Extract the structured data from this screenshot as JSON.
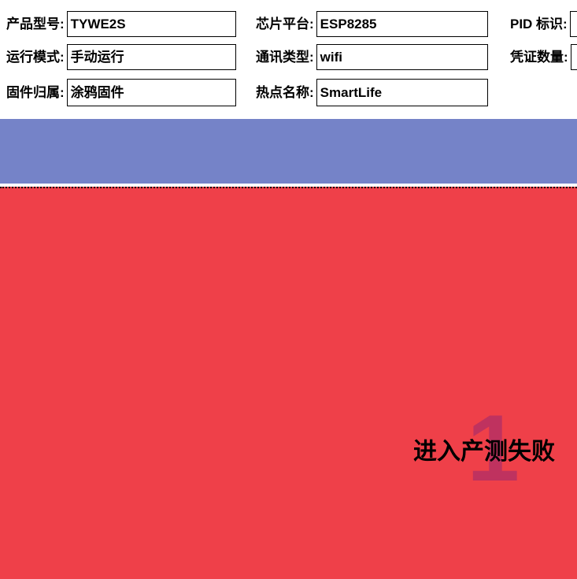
{
  "form": {
    "fields": [
      {
        "label": "产品型号:",
        "value": "TYWE2S",
        "name": "product-model"
      },
      {
        "label": "芯片平台:",
        "value": "ESP8285",
        "name": "chip-platform"
      },
      {
        "label": "PID 标识:",
        "value": "",
        "name": "pid-identifier"
      },
      {
        "label": "运行模式:",
        "value": "手动运行",
        "name": "run-mode"
      },
      {
        "label": "通讯类型:",
        "value": "wifi",
        "name": "comm-type"
      },
      {
        "label": "凭证数量:",
        "value": "",
        "name": "credential-count"
      },
      {
        "label": "固件归属:",
        "value": "涂鸦固件",
        "name": "firmware-owner"
      },
      {
        "label": "热点名称:",
        "value": "SmartLife",
        "name": "hotspot-name"
      }
    ]
  },
  "panels": {
    "progress_panel_color": "#7583c8",
    "status_panel_color": "#ef4049"
  },
  "status": {
    "counter": "1",
    "message": "进入产测失败"
  }
}
